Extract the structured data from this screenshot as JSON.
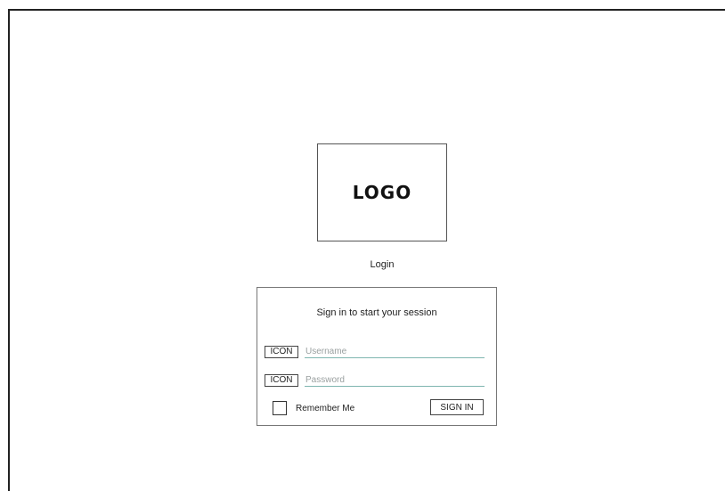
{
  "logo": {
    "text": "LOGO"
  },
  "page_title": "Login",
  "panel": {
    "title": "Sign in to start your session",
    "username": {
      "icon_label": "ICON",
      "placeholder": "Username",
      "value": ""
    },
    "password": {
      "icon_label": "ICON",
      "placeholder": "Password",
      "value": ""
    },
    "remember_label": "Remember Me",
    "remember_checked": false,
    "signin_label": "SIGN IN"
  },
  "colors": {
    "frame": "#222222",
    "input_underline": "#7fb6b0"
  }
}
